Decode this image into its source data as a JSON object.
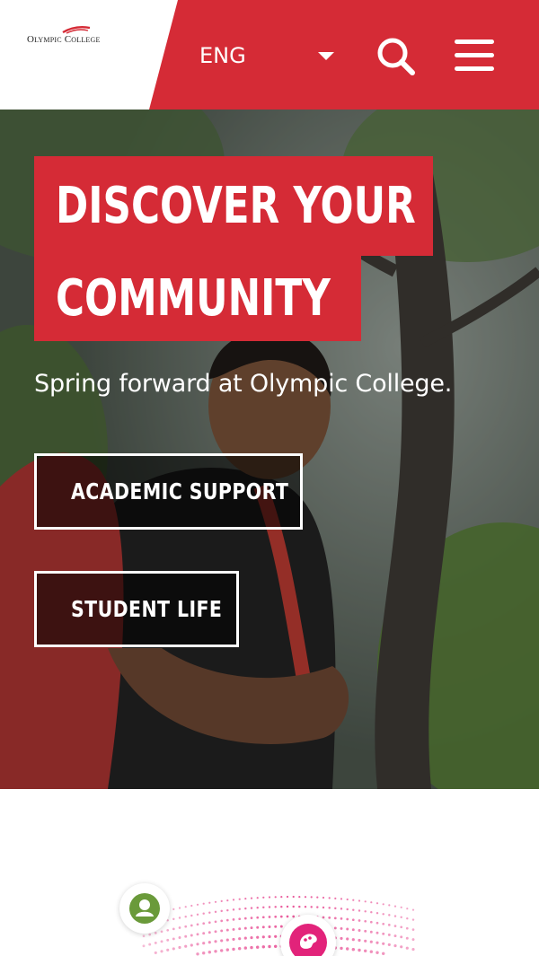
{
  "header": {
    "logo_text": "Olympic College",
    "language": "ENG",
    "icons": {
      "search": "search-icon",
      "menu": "hamburger-menu-icon",
      "caret": "caret-down-icon"
    }
  },
  "hero": {
    "headline_line1": "DISCOVER YOUR",
    "headline_line2": "COMMUNITY",
    "subtitle": "Spring forward at Olympic College.",
    "buttons": [
      {
        "label": "ACADEMIC SUPPORT"
      },
      {
        "label": "STUDENT LIFE"
      }
    ]
  },
  "bottom": {
    "icons": [
      "person-icon",
      "palette-icon"
    ]
  },
  "colors": {
    "brand_red": "#d52b36",
    "white": "#ffffff",
    "green": "#6a9a3a",
    "pink": "#e2237a"
  }
}
